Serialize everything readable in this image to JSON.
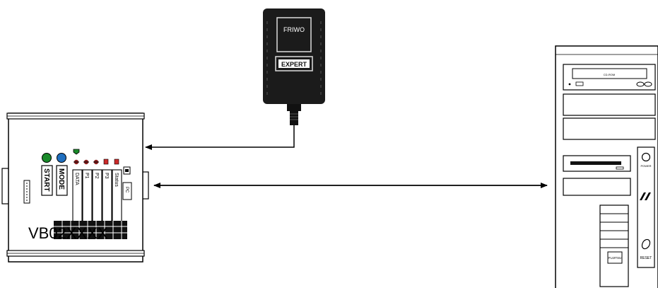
{
  "adapter": {
    "brand": "FRIWO",
    "badge": "EXPERT"
  },
  "device": {
    "model_label": "VB02XXXX",
    "start_label": "START",
    "mode_label": "MODE",
    "leds": [
      "DATA",
      "P1",
      "P2",
      "P3",
      "Status"
    ],
    "side_label": "PC",
    "colors": {
      "start": "#1a8a2a",
      "mode": "#1f6fbf",
      "status_green": "#1a8a2a",
      "led_red": "#cc2a2a"
    }
  },
  "pc": {
    "cd_label": "CD-ROM",
    "power_label": "POWER",
    "reset_label": "RESET",
    "logo": "FUJITSU"
  }
}
